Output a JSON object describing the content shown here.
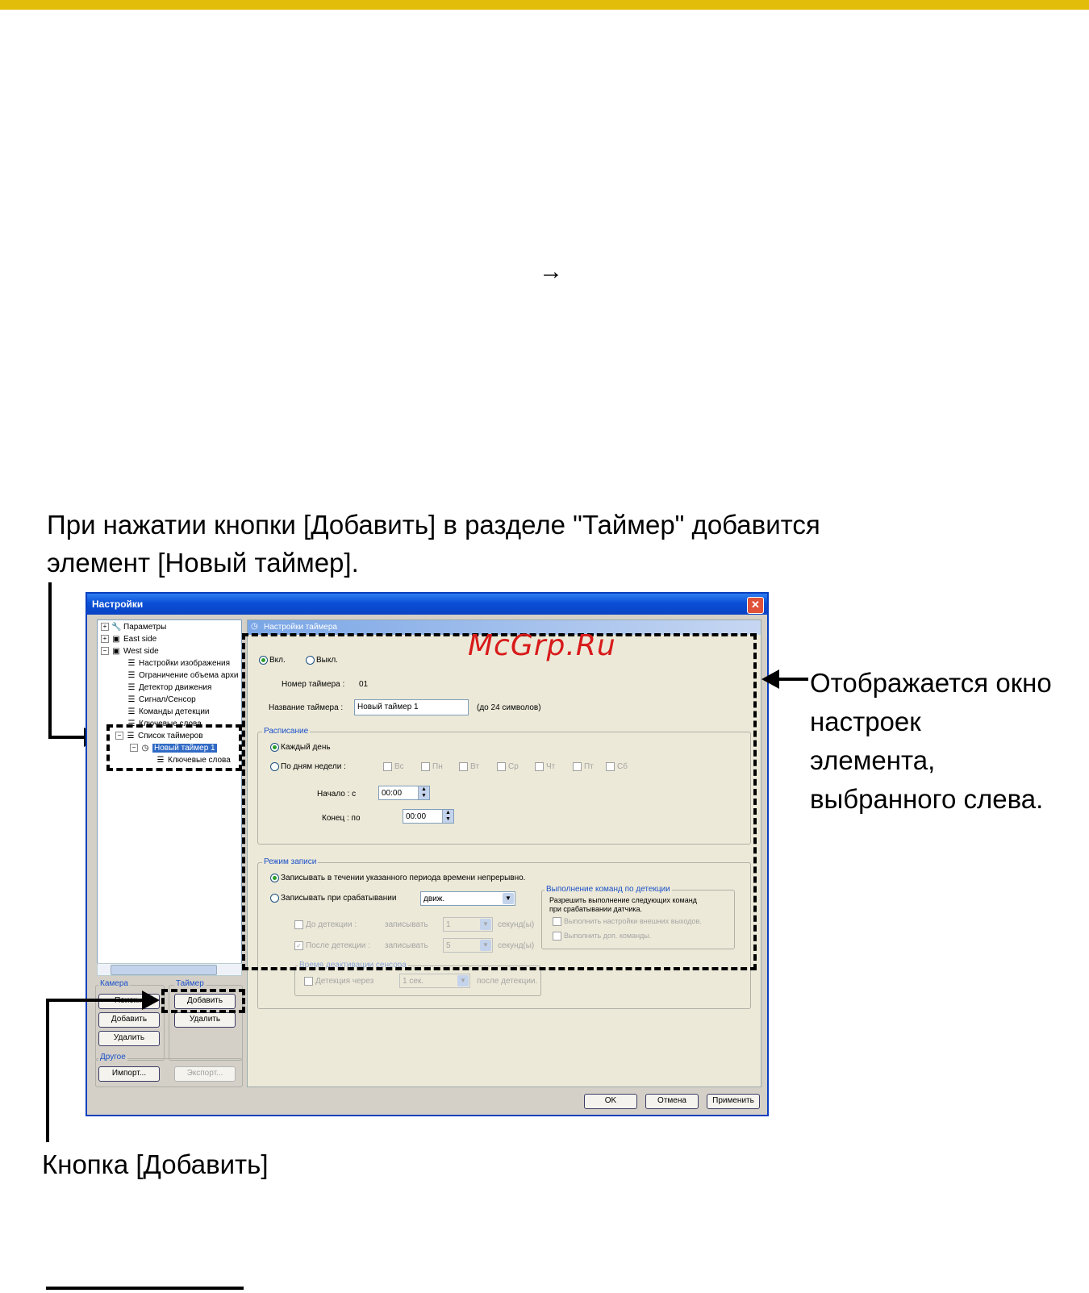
{
  "page": {
    "arrow": "→",
    "caption_top": "При нажатии кнопки [Добавить] в разделе \"Таймер\" добавится элемент [Новый таймер].",
    "caption_right": "Отображается окно настроек элемента, выбранного слева.",
    "caption_bottom": "Кнопка [Добавить]",
    "watermark": "McGrp.Ru",
    "accent_color": "#e2bd0a"
  },
  "dialog": {
    "title": "Настройки",
    "close": "✕",
    "tree": [
      {
        "label": "Параметры",
        "icon": "wrench-icon",
        "expander": "+"
      },
      {
        "label": "East side",
        "icon": "camera-icon",
        "expander": "+"
      },
      {
        "label": "West side",
        "icon": "camera-icon",
        "expander": "−"
      },
      {
        "label": "Настройки изображения",
        "icon": "list-icon"
      },
      {
        "label": "Ограничение объема архи",
        "icon": "list-icon"
      },
      {
        "label": "Детектор движения",
        "icon": "list-icon"
      },
      {
        "label": "Сигнал/Сенсор",
        "icon": "list-icon"
      },
      {
        "label": "Команды детекции",
        "icon": "list-icon"
      },
      {
        "label": "Ключевые слова",
        "icon": "list-icon"
      },
      {
        "label": "Список таймеров",
        "icon": "list-icon",
        "expander": "−"
      },
      {
        "label": "Новый таймер 1",
        "icon": "clock-icon",
        "expander": "−"
      },
      {
        "label": "Ключевые слова",
        "icon": "list-icon"
      }
    ],
    "groups": {
      "camera": {
        "label": "Камера",
        "search": "Поиск...",
        "add": "Добавить",
        "delete": "Удалить"
      },
      "timer": {
        "label": "Таймер",
        "add": "Добавить",
        "delete": "Удалить"
      },
      "other": {
        "label": "Другое",
        "import": "Импорт...",
        "export": "Экспорт..."
      }
    },
    "panel": {
      "header": "Настройки таймера",
      "on": "Вкл.",
      "off": "Выкл.",
      "timer_number_label": "Номер таймера :",
      "timer_number": "01",
      "timer_name_label": "Название таймера :",
      "timer_name": "Новый таймер 1",
      "timer_name_hint": "(до 24 символов)",
      "schedule": {
        "label": "Расписание",
        "every_day": "Каждый день",
        "weekdays": "По дням недели :",
        "days": [
          "Вс",
          "Пн",
          "Вт",
          "Ср",
          "Чт",
          "Пт",
          "Сб"
        ],
        "start_label": "Начало : с",
        "start": "00:00",
        "end_label": "Конец : по",
        "end": "00:00"
      },
      "record": {
        "label": "Режим записи",
        "continuous": "Записывать в течении указанного периода времени непрерывно.",
        "on_trigger": "Записывать при срабатывании",
        "trigger_value": "движ.",
        "pre": "До детекции :",
        "pre_word": "записывать",
        "pre_value": "1",
        "post": "После детекции :",
        "post_word": "записывать",
        "post_value": "5",
        "seconds": "секунд(ы)",
        "commands": {
          "label": "Выполнение команд по детекции",
          "line1": "Разрешить выполнение следующих команд",
          "line2": "при срабатывании датчика.",
          "opt1": "Выполнить настройки внешних выходов.",
          "opt2": "Выполнить доп. команды."
        },
        "sensor": {
          "label": "Время деактивации сенсора",
          "detect": "Детекция через",
          "value": "1 сек.",
          "after": "после детекции."
        }
      }
    },
    "buttons": {
      "ok": "OK",
      "cancel": "Отмена",
      "apply": "Применить"
    }
  }
}
